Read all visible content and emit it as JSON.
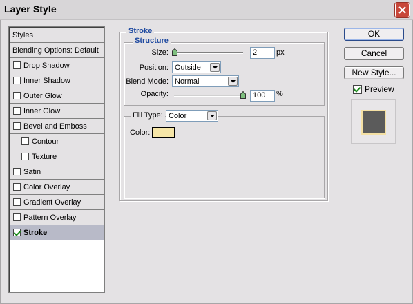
{
  "window": {
    "title": "Layer Style"
  },
  "styles_panel": {
    "header": "Styles",
    "blending": "Blending Options: Default",
    "items": [
      {
        "label": "Drop Shadow",
        "checked": false,
        "indent": false,
        "selected": false
      },
      {
        "label": "Inner Shadow",
        "checked": false,
        "indent": false,
        "selected": false
      },
      {
        "label": "Outer Glow",
        "checked": false,
        "indent": false,
        "selected": false
      },
      {
        "label": "Inner Glow",
        "checked": false,
        "indent": false,
        "selected": false
      },
      {
        "label": "Bevel and Emboss",
        "checked": false,
        "indent": false,
        "selected": false
      },
      {
        "label": "Contour",
        "checked": false,
        "indent": true,
        "selected": false
      },
      {
        "label": "Texture",
        "checked": false,
        "indent": true,
        "selected": false
      },
      {
        "label": "Satin",
        "checked": false,
        "indent": false,
        "selected": false
      },
      {
        "label": "Color Overlay",
        "checked": false,
        "indent": false,
        "selected": false
      },
      {
        "label": "Gradient Overlay",
        "checked": false,
        "indent": false,
        "selected": false
      },
      {
        "label": "Pattern Overlay",
        "checked": false,
        "indent": false,
        "selected": false
      },
      {
        "label": "Stroke",
        "checked": true,
        "indent": false,
        "selected": true
      }
    ]
  },
  "stroke": {
    "title": "Stroke",
    "structure": {
      "title": "Structure",
      "size_label": "Size:",
      "size_value": "2",
      "size_unit": "px",
      "size_fraction": 0.01,
      "position_label": "Position:",
      "position_value": "Outside",
      "blend_label": "Blend Mode:",
      "blend_value": "Normal",
      "opacity_label": "Opacity:",
      "opacity_value": "100",
      "opacity_unit": "%",
      "opacity_fraction": 1.0
    },
    "fill": {
      "type_label": "Fill Type:",
      "type_value": "Color",
      "color_label": "Color:",
      "color_hex": "#f6e6a8"
    }
  },
  "buttons": {
    "ok": "OK",
    "cancel": "Cancel",
    "new_style": "New Style...",
    "preview_label": "Preview",
    "preview_checked": true
  },
  "colors": {
    "accent_text": "#1f4aa0",
    "selected_row": "#b8bac8",
    "close_button": "#c8473a"
  }
}
